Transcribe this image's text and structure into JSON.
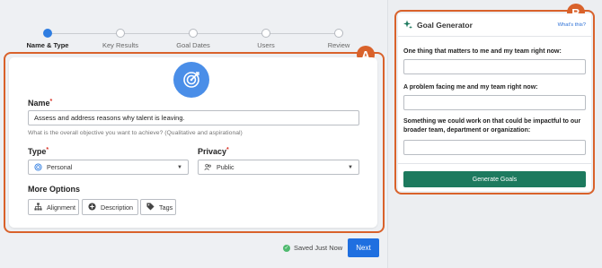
{
  "stepper": {
    "steps": [
      {
        "label": "Name & Type",
        "active": true
      },
      {
        "label": "Key Results",
        "active": false
      },
      {
        "label": "Goal Dates",
        "active": false
      },
      {
        "label": "Users",
        "active": false
      },
      {
        "label": "Review",
        "active": false
      }
    ]
  },
  "annotations": {
    "a": "A",
    "b": "B"
  },
  "form": {
    "name_label": "Name",
    "required_mark": "*",
    "name_value": "Assess and address reasons why talent is leaving.",
    "name_hint": "What is the overall objective you want to achieve? (Qualitative and aspirational)",
    "type_label": "Type",
    "type_value": "Personal",
    "privacy_label": "Privacy",
    "privacy_value": "Public",
    "more_options_label": "More Options",
    "options": [
      {
        "label": "Alignment",
        "icon": "hierarchy-icon"
      },
      {
        "label": "Description",
        "icon": "plus-circle-icon"
      },
      {
        "label": "Tags",
        "icon": "tag-icon"
      }
    ]
  },
  "footer": {
    "saved_text": "Saved Just Now",
    "next_label": "Next"
  },
  "generator": {
    "title": "Goal Generator",
    "whats_this": "What's this?",
    "questions": [
      {
        "label": "One thing that matters to me and my team right now:",
        "value": ""
      },
      {
        "label": "A problem facing me and my team right now:",
        "value": ""
      },
      {
        "label": "Something we could work on that could be impactful to our broader team, department or organization:",
        "value": ""
      }
    ],
    "button_label": "Generate Goals"
  },
  "colors": {
    "accent_blue": "#1f6fe0",
    "annotation_orange": "#d9622b",
    "generate_green": "#1d7a5e"
  }
}
